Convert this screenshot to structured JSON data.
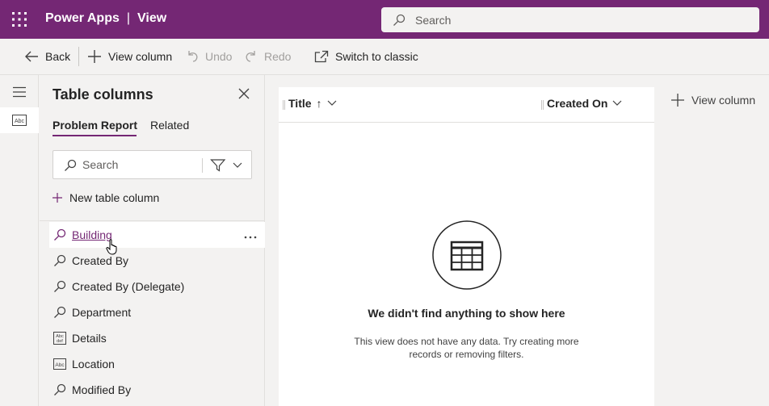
{
  "header": {
    "app_name": "Power Apps",
    "separator": "|",
    "page_name": "View",
    "search_placeholder": "Search",
    "brand_color": "#742774"
  },
  "commands": {
    "back": "Back",
    "view_column": "View column",
    "undo": "Undo",
    "redo": "Redo",
    "switch_classic": "Switch to classic"
  },
  "panel": {
    "title": "Table columns",
    "tabs": [
      "Problem Report",
      "Related"
    ],
    "active_tab": "Problem Report",
    "search_placeholder": "Search",
    "new_column": "New table column",
    "columns": [
      {
        "label": "Building",
        "icon": "lookup-icon"
      },
      {
        "label": "Created By",
        "icon": "lookup-icon"
      },
      {
        "label": "Created By (Delegate)",
        "icon": "lookup-icon"
      },
      {
        "label": "Department",
        "icon": "lookup-icon"
      },
      {
        "label": "Details",
        "icon": "multiline-text-icon"
      },
      {
        "label": "Location",
        "icon": "text-icon"
      },
      {
        "label": "Modified By",
        "icon": "lookup-icon"
      }
    ]
  },
  "grid": {
    "columns": [
      {
        "label": "Title",
        "sort": "ascending"
      },
      {
        "label": "Created On",
        "sort": ""
      }
    ],
    "sort_indicator": "↑",
    "empty_title": "We didn't find anything to show here",
    "empty_text": "This view does not have any data. Try creating more records or removing filters.",
    "add_column": "View column"
  }
}
